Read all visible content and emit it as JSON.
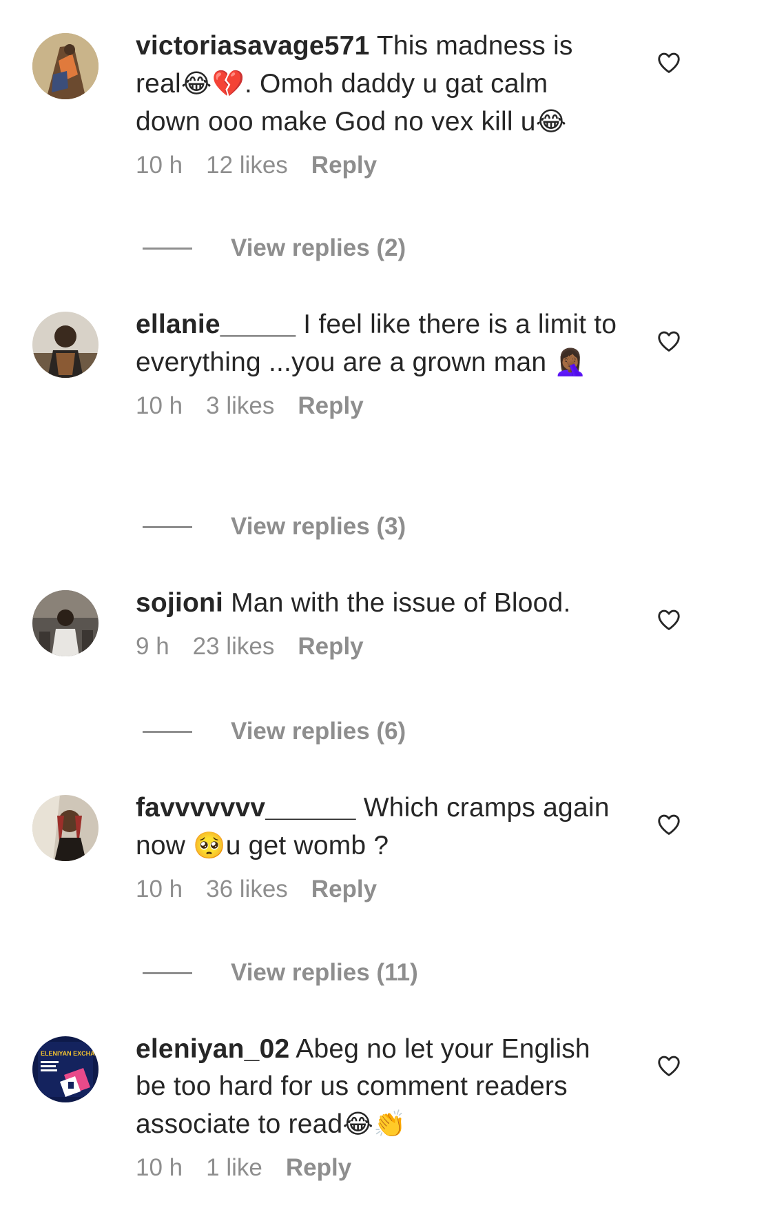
{
  "comments": [
    {
      "username": "victoriasavage571",
      "text_parts": [
        " This madness is real",
        "😂💔",
        ". Omoh daddy u gat calm down ooo make God no vex kill u",
        "😂"
      ],
      "time": "10 h",
      "likes": "12 likes",
      "reply_label": "Reply",
      "view_replies": "View replies (2)"
    },
    {
      "username": "ellanie_____",
      "text_parts": [
        " I feel like there is a limit to everything ...you are a grown man ",
        "🤦🏾‍♀️"
      ],
      "time": "10 h",
      "likes": "3 likes",
      "reply_label": "Reply",
      "view_replies": "View replies (3)"
    },
    {
      "username": "sojioni",
      "text_parts": [
        " Man with the issue of Blood."
      ],
      "time": "9 h",
      "likes": "23 likes",
      "reply_label": "Reply",
      "view_replies": "View replies (6)"
    },
    {
      "username": "favvvvvvv______",
      "text_parts": [
        " Which cramps again now ",
        "🥺",
        "u get womb ?"
      ],
      "time": "10 h",
      "likes": "36 likes",
      "reply_label": "Reply",
      "view_replies": "View replies (11)"
    },
    {
      "username": "eleniyan_02",
      "text_parts": [
        " Abeg no let your English be too hard for us comment readers associate to read",
        "😂👏"
      ],
      "time": "10 h",
      "likes": "1 like",
      "reply_label": "Reply"
    }
  ],
  "avatars": {
    "eleniyan_02": "ELENIYAN EXCHANGE"
  },
  "colors": {
    "text": "#262626",
    "secondary": "#8e8e8e",
    "background": "#ffffff"
  },
  "icons": {
    "like": "heart-outline-icon"
  }
}
